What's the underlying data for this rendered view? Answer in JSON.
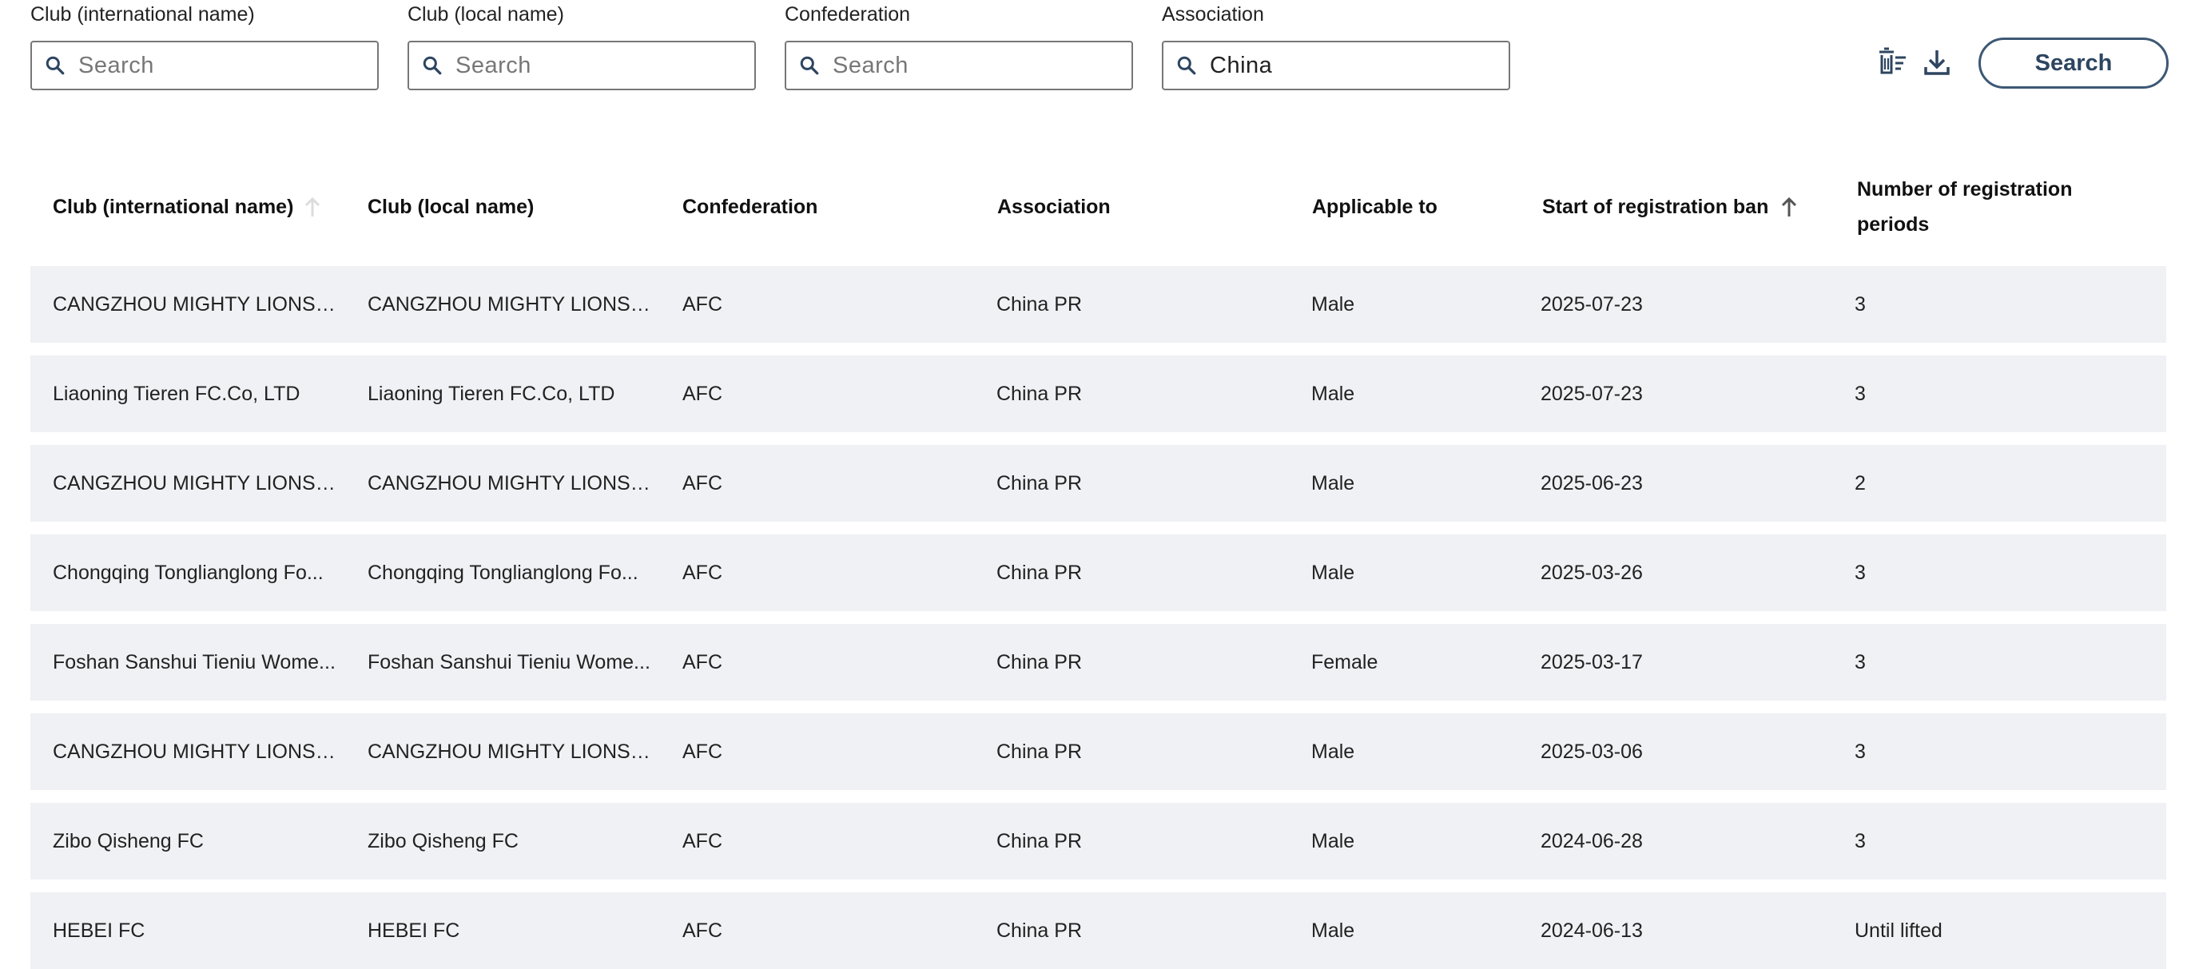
{
  "filters": [
    {
      "label": "Club (international name)",
      "value": "",
      "placeholder": "Search"
    },
    {
      "label": "Club (local name)",
      "value": "",
      "placeholder": "Search"
    },
    {
      "label": "Confederation",
      "value": "",
      "placeholder": "Search"
    },
    {
      "label": "Association",
      "value": "China",
      "placeholder": "Search"
    }
  ],
  "toolbar": {
    "clear_icon": "clear-filter-icon",
    "download_icon": "download-icon",
    "search_label": "Search"
  },
  "colors": {
    "accent": "#3d5874",
    "row_bg": "#f0f1f4",
    "border": "#777777"
  },
  "table": {
    "headers": [
      "Club (international name)",
      "Club (local name)",
      "Confederation",
      "Association",
      "Applicable to",
      "Start of registration ban",
      "Number of registration periods"
    ],
    "sorted_column": "Start of registration ban",
    "rows": [
      [
        "CANGZHOU MIGHTY LIONS F...",
        "CANGZHOU MIGHTY LIONS F...",
        "AFC",
        "China PR",
        "Male",
        "2025-07-23",
        "3"
      ],
      [
        "Liaoning Tieren FC.Co, LTD",
        "Liaoning Tieren FC.Co, LTD",
        "AFC",
        "China PR",
        "Male",
        "2025-07-23",
        "3"
      ],
      [
        "CANGZHOU MIGHTY LIONS F...",
        "CANGZHOU MIGHTY LIONS F...",
        "AFC",
        "China PR",
        "Male",
        "2025-06-23",
        "2"
      ],
      [
        "Chongqing Tonglianglong Fo...",
        "Chongqing Tonglianglong Fo...",
        "AFC",
        "China PR",
        "Male",
        "2025-03-26",
        "3"
      ],
      [
        "Foshan Sanshui Tieniu Wome...",
        "Foshan Sanshui Tieniu Wome...",
        "AFC",
        "China PR",
        "Female",
        "2025-03-17",
        "3"
      ],
      [
        "CANGZHOU MIGHTY LIONS F...",
        "CANGZHOU MIGHTY LIONS F...",
        "AFC",
        "China PR",
        "Male",
        "2025-03-06",
        "3"
      ],
      [
        "Zibo Qisheng FC",
        "Zibo Qisheng FC",
        "AFC",
        "China PR",
        "Male",
        "2024-06-28",
        "3"
      ],
      [
        "HEBEI FC",
        "HEBEI FC",
        "AFC",
        "China PR",
        "Male",
        "2024-06-13",
        "Until lifted"
      ]
    ]
  }
}
